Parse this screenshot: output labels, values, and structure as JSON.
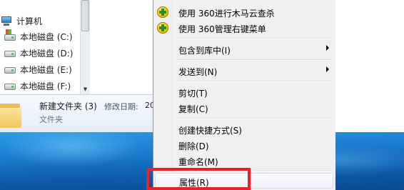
{
  "explorer": {
    "nav_items": [
      {
        "label": "计算机",
        "icon": "computer-icon"
      },
      {
        "label": "本地磁盘 (C:)",
        "icon": "system-drive-icon"
      },
      {
        "label": "本地磁盘 (D:)",
        "icon": "drive-icon"
      },
      {
        "label": "本地磁盘 (E:)",
        "icon": "drive-icon"
      },
      {
        "label": "本地磁盘 (F:)",
        "icon": "drive-icon"
      }
    ],
    "details": {
      "name": "新建文件夹 (3)",
      "date_label": "修改日期:",
      "date_value": "20",
      "type": "文件夹"
    }
  },
  "context_menu": {
    "items": [
      {
        "label": "使用 360进行木马云查杀",
        "icon": "360-shield-icon",
        "submenu": false
      },
      {
        "label": "使用 360管理右键菜单",
        "icon": "360-shield-icon",
        "submenu": false
      },
      {
        "label": "包含到库中(I)",
        "submenu": true
      },
      {
        "label": "发送到(N)",
        "submenu": true
      },
      {
        "label": "剪切(T)",
        "submenu": false
      },
      {
        "label": "复制(C)",
        "submenu": false
      },
      {
        "label": "创建快捷方式(S)",
        "submenu": false
      },
      {
        "label": "删除(D)",
        "submenu": false
      },
      {
        "label": "重命名(M)",
        "submenu": false
      },
      {
        "label": "属性(R)",
        "submenu": false
      }
    ],
    "highlight_color": "#e6222b"
  },
  "colors": {
    "menu_bg": "#f0f0f0",
    "desktop_blue": "#1a78c9",
    "details_bg": "#e4edf7"
  }
}
